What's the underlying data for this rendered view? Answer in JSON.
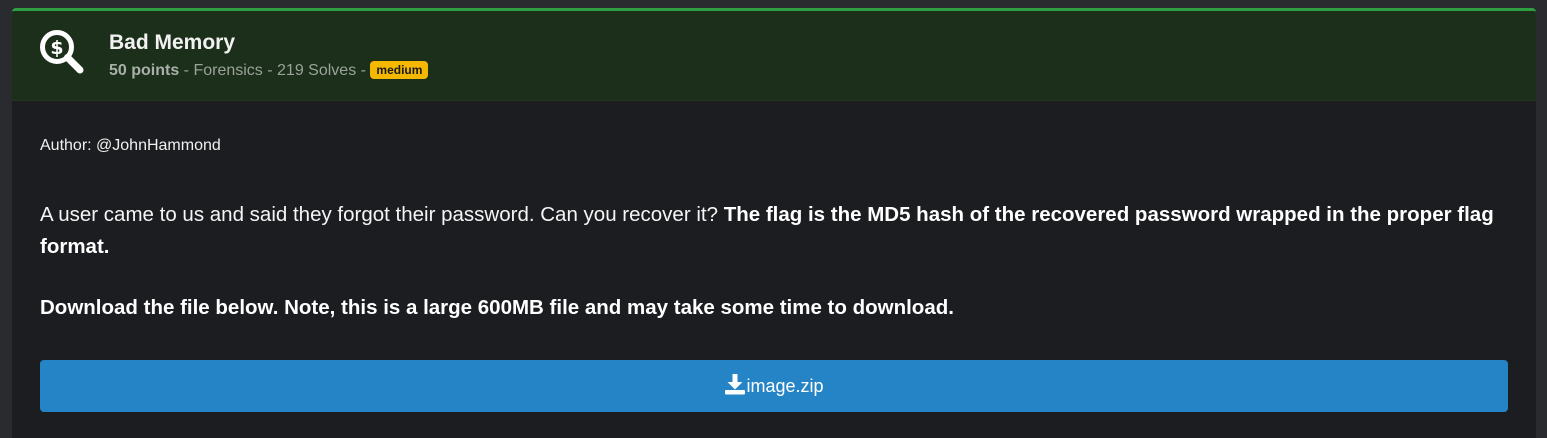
{
  "challenge": {
    "title": "Bad Memory",
    "points": "50 points",
    "category_solves": " - Forensics - 219 Solves - ",
    "difficulty": "medium",
    "icon": "dollar-search-icon",
    "author": "Author: @JohnHammond",
    "description_plain": "A user came to us and said they forgot their password. Can you recover it? ",
    "description_bold": "The flag is the MD5 hash of the recovered password wrapped in the proper flag format.",
    "note": "Download the file below. Note, this is a large 600MB file and may take some time to download.",
    "download_label": "image.zip",
    "download_icon": "download-icon"
  },
  "colors": {
    "accent_green": "#2ea043",
    "header_bg": "#1b2f1a",
    "badge": "#f5b800",
    "button": "#2484c6"
  }
}
